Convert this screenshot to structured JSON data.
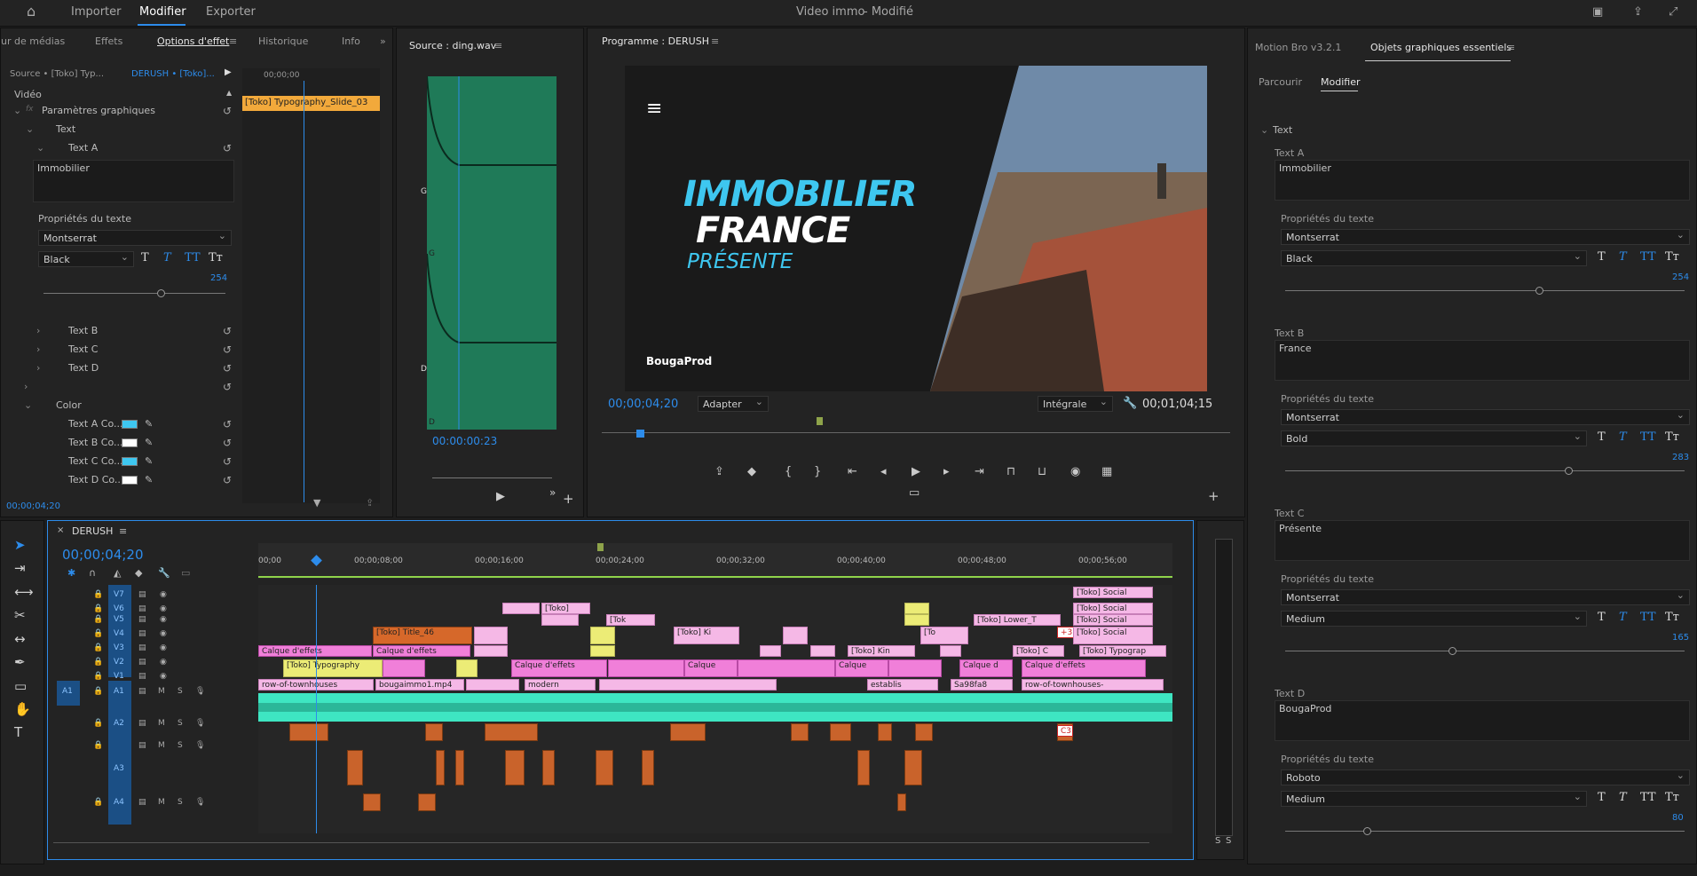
{
  "menubar": {
    "home_icon": "home-icon",
    "items": [
      "Importer",
      "Modifier",
      "Exporter"
    ],
    "active": "Modifier",
    "title": "Video immo",
    "status": "- Modifié"
  },
  "left_panel": {
    "tabs": [
      "ur de médias",
      "Effets",
      "Options d'effet",
      "Historique",
      "Info"
    ],
    "source_label": "Source • [Toko] Typ...",
    "sequence_label": "DERUSH • [Toko]...",
    "section_video": "Vidéo",
    "params": "Paramètres graphiques",
    "text_group": "Text",
    "text_a": "Text A",
    "text_a_value": "Immobilier",
    "props_label": "Propriétés du texte",
    "font": "Montserrat",
    "weight": "Black",
    "size": "254",
    "text_b": "Text B",
    "text_c": "Text C",
    "text_d": "Text D",
    "color_group": "Color",
    "color_rows": [
      {
        "label": "Text A Co...",
        "color": "#3ec7f0"
      },
      {
        "label": "Text B Co...",
        "color": "#ffffff"
      },
      {
        "label": "Text C Co...",
        "color": "#3ec7f0"
      },
      {
        "label": "Text D Co...",
        "color": "#ffffff"
      }
    ],
    "timecode": "00;00;04;20",
    "mini_timecode": "00;00;00",
    "clip_label": "[Toko] Typography_Slide_03"
  },
  "source_panel": {
    "title": "Source : ding.wav",
    "timecode": "00:00:00:23",
    "marks": [
      "G",
      "G",
      "D",
      "D"
    ]
  },
  "program_panel": {
    "title": "Programme : DERUSH",
    "line1": "IMMOBILIER",
    "line2": "FRANCE",
    "line3": "PRÉSENTE",
    "brand": "BougaProd",
    "timecode": "00;00;04;20",
    "fit": "Adapter",
    "quality": "Intégrale",
    "duration": "00;01;04;15"
  },
  "timeline": {
    "title": "DERUSH",
    "timecode": "00;00;04;20",
    "ruler": [
      "00;00",
      "00;00;08;00",
      "00;00;16;00",
      "00;00;24;00",
      "00;00;32;00",
      "00;00;40;00",
      "00;00;48;00",
      "00;00;56;00"
    ],
    "video_tracks": [
      "V7",
      "V6",
      "V5",
      "V4",
      "V3",
      "V2",
      "V1"
    ],
    "audio_tracks": [
      "A1",
      "A2",
      "A3",
      "A4"
    ],
    "source_patch": "A1",
    "clips": {
      "social1": "[Toko] Social",
      "social2": "[Toko] Social",
      "social3": "[Toko] Social",
      "social4": "[Toko] Social",
      "toko_v6": "[Toko]",
      "tok_v5": "[Tok",
      "lower": "[Toko] Lower_T",
      "title46": "[Toko] Title_46",
      "toko_ki": "[Toko] Ki",
      "to": "[To",
      "plus3": "+3",
      "calque1": "Calque d'effets",
      "calque2": "Calque d'effets",
      "calque3": "Calque d'effets",
      "calque4": "Calque",
      "calque5": "Calque",
      "calque6": "Calque d",
      "calque7": "Calque d'effets",
      "toko_kin": "[Toko] Kin",
      "toko_c": "[Toko] C",
      "toko_typograp": "[Toko] Typograp",
      "typography": "[Toko] Typography",
      "row1": "row-of-townhouses",
      "bougaimmo": "bougaimmo1.mp4",
      "modern": "modern",
      "establis": "establis",
      "sa98": "Sa98fa8",
      "row2": "row-of-townhouses-",
      "c3": "C3"
    },
    "track_btns": {
      "m": "M",
      "s": "S"
    }
  },
  "right_panel": {
    "tabs": [
      "Motion Bro v3.2.1",
      "Objets graphiques essentiels"
    ],
    "subtabs": [
      "Parcourir",
      "Modifier"
    ],
    "section": "Text",
    "props_label": "Propriétés du texte",
    "blocks": [
      {
        "label": "Text A",
        "value": "Immobilier",
        "font": "Montserrat",
        "weight": "Black",
        "size": "254"
      },
      {
        "label": "Text B",
        "value": "France",
        "font": "Montserrat",
        "weight": "Bold",
        "size": "283"
      },
      {
        "label": "Text C",
        "value": "Présente",
        "font": "Montserrat",
        "weight": "Medium",
        "size": "165"
      },
      {
        "label": "Text D",
        "value": "BougaProd",
        "font": "Roboto",
        "weight": "Medium",
        "size": "80"
      }
    ]
  },
  "meters": {
    "labels": [
      "S",
      "S"
    ]
  }
}
